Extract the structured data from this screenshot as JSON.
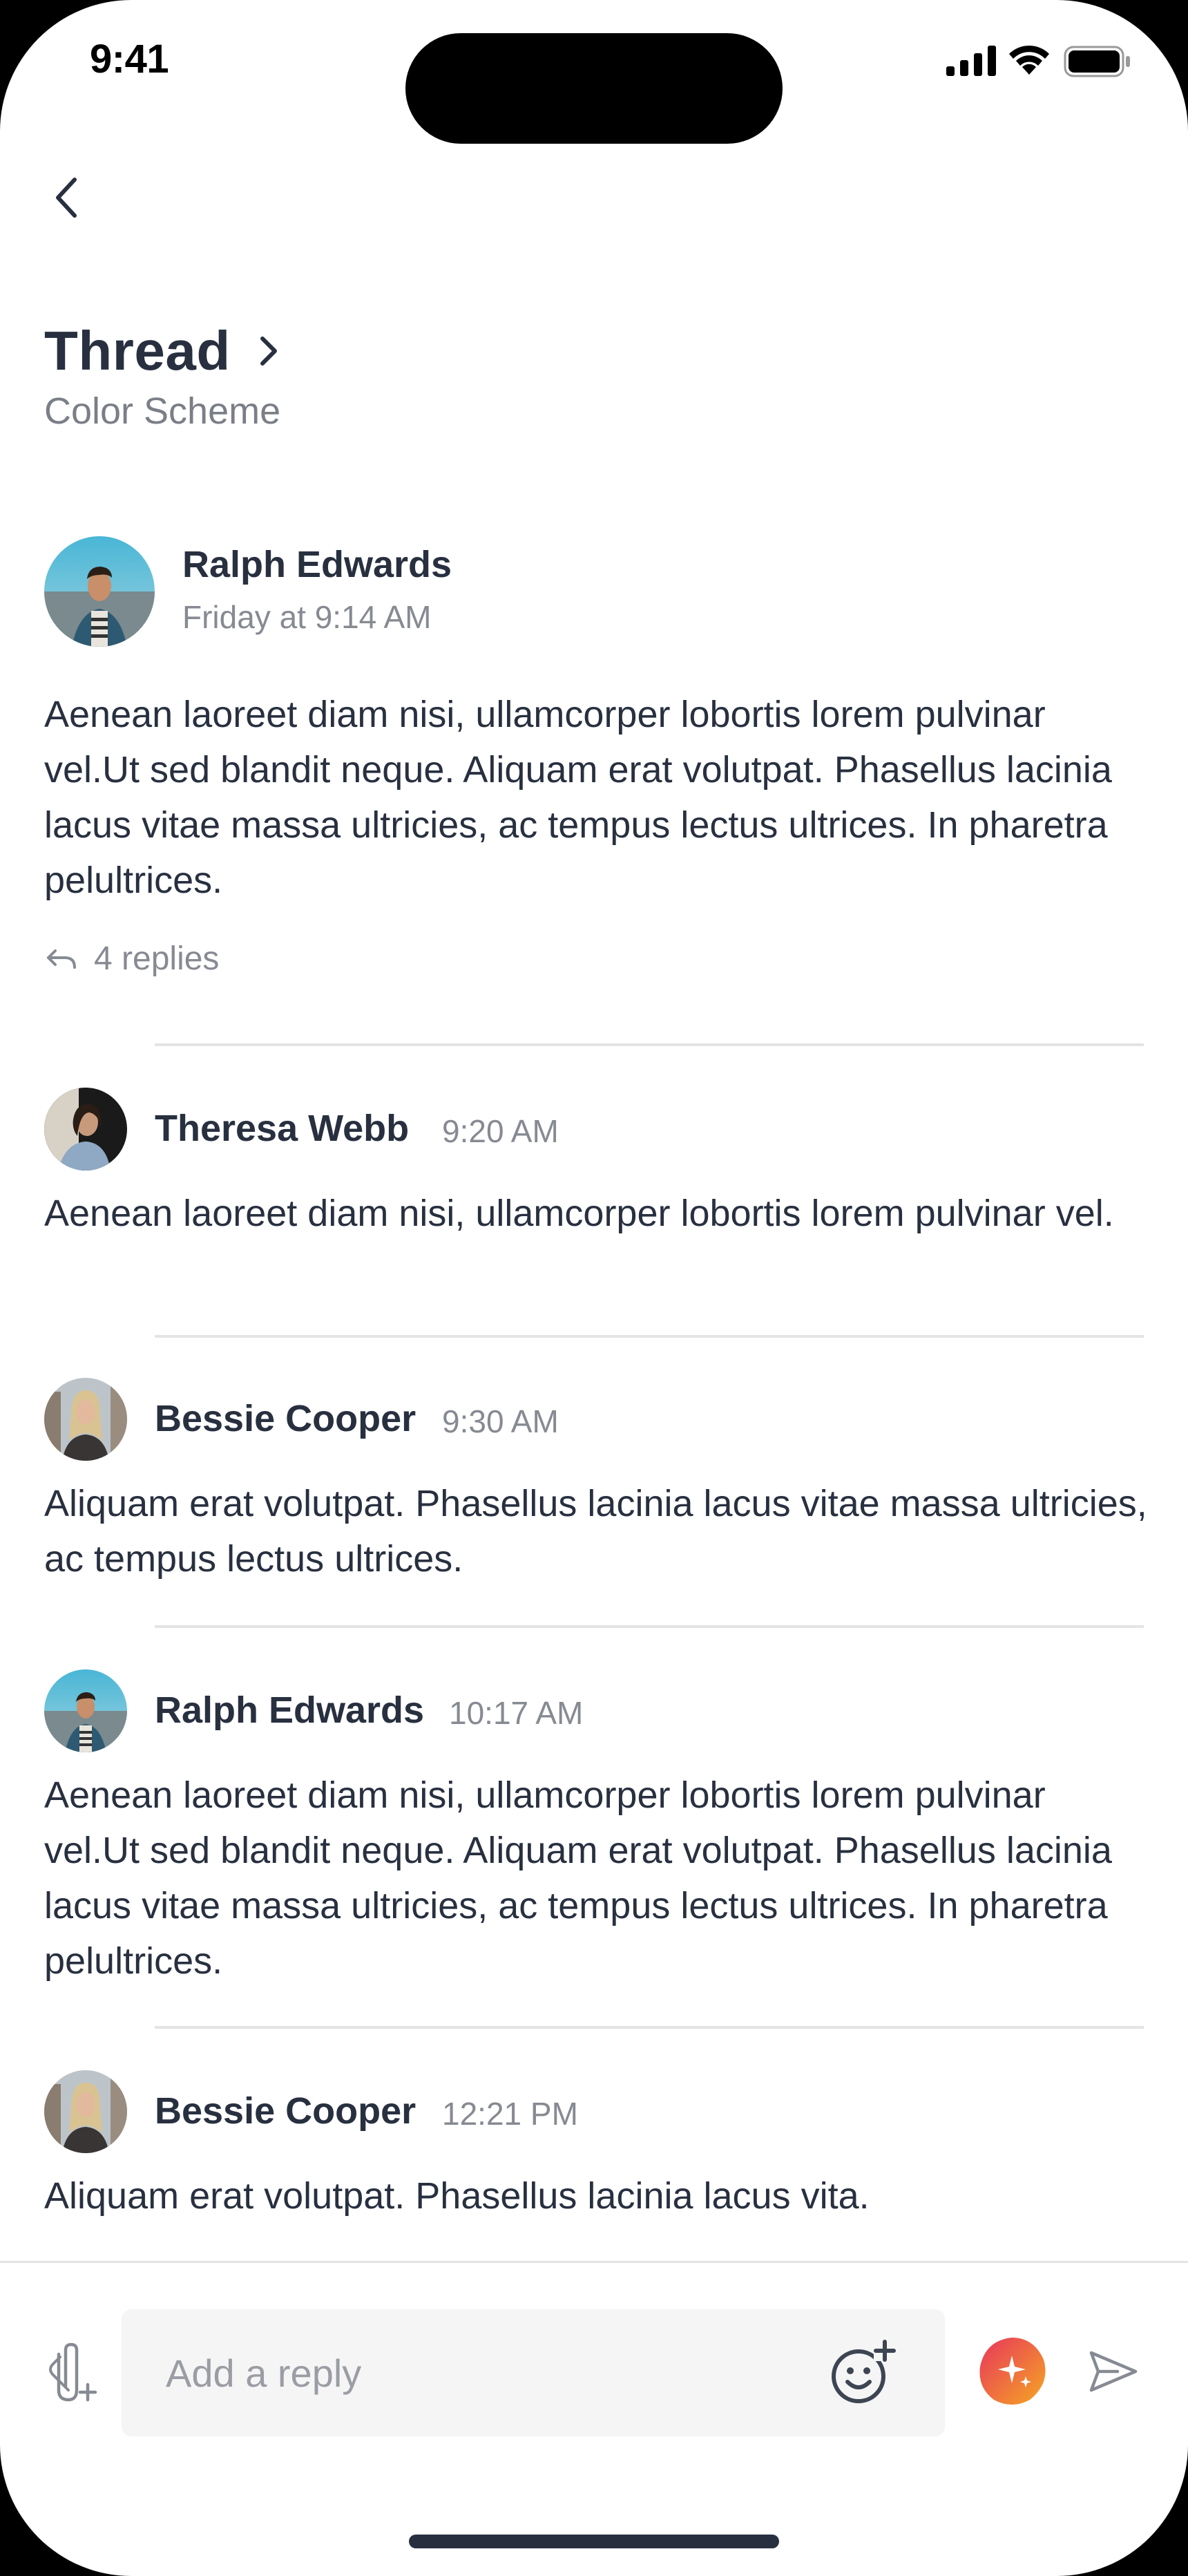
{
  "status_bar": {
    "time": "9:41"
  },
  "header": {
    "title": "Thread",
    "subtitle": "Color Scheme"
  },
  "parent": {
    "author": "Ralph Edwards",
    "timestamp": "Friday at 9:14 AM",
    "body": "Aenean laoreet diam nisi, ullamcorper lobortis lorem pulvinar vel.Ut sed blandit neque. Aliquam erat volutpat. Phasellus lacinia lacus vitae massa ultricies, ac tempus lectus ultrices. In pharetra pelultrices.",
    "replies_label": "4 replies"
  },
  "replies": [
    {
      "author": "Theresa Webb",
      "time": "9:20 AM",
      "body": "Aenean laoreet diam nisi, ullamcorper lobortis lorem pulvinar vel."
    },
    {
      "author": "Bessie Cooper",
      "time": "9:30 AM",
      "body": "Aliquam erat volutpat. Phasellus lacinia lacus vitae massa ultricies, ac tempus lectus ultrices."
    },
    {
      "author": "Ralph Edwards",
      "time": "10:17 AM",
      "body": "Aenean laoreet diam nisi, ullamcorper lobortis lorem pulvinar vel.Ut sed blandit neque. Aliquam erat volutpat. Phasellus lacinia lacus vitae massa ultricies, ac tempus lectus ultrices. In pharetra pelultrices."
    },
    {
      "author": "Bessie Cooper",
      "time": "12:21 PM",
      "body": "Aliquam erat volutpat. Phasellus lacinia lacus vita."
    }
  ],
  "composer": {
    "placeholder": "Add a reply",
    "value": ""
  },
  "colors": {
    "text_primary": "#283040",
    "text_secondary": "#868a92",
    "divider": "#e3e4e6",
    "ai_gradient_start": "#e8365d",
    "ai_gradient_end": "#f5a623"
  },
  "icons": {
    "back": "chevron-left-icon",
    "title_chevron": "chevron-right-icon",
    "replies": "reply-arrow-icon",
    "attach": "attachment-add-icon",
    "emoji": "emoji-add-icon",
    "ai": "sparkle-ai-icon",
    "send": "send-icon"
  }
}
